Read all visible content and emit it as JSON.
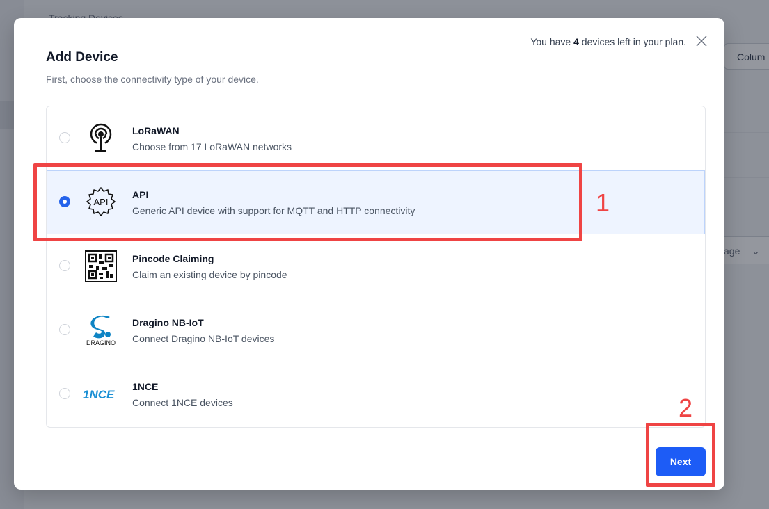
{
  "background": {
    "page_title": "Tracking Devices",
    "columns_label": "Colum",
    "page_select_label": "age"
  },
  "modal": {
    "title": "Add Device",
    "subtitle": "First, choose the connectivity type of your device.",
    "plan_prefix": "You have ",
    "plan_count": "4",
    "plan_suffix": " devices left in your plan.",
    "options": [
      {
        "name": "LoRaWAN",
        "desc": "Choose from 17 LoRaWAN networks",
        "icon": "antenna-icon",
        "selected": false
      },
      {
        "name": "API",
        "desc": "Generic API device with support for MQTT and HTTP connectivity",
        "icon": "api-gear-icon",
        "selected": true
      },
      {
        "name": "Pincode Claiming",
        "desc": "Claim an existing device by pincode",
        "icon": "qr-code-icon",
        "selected": false
      },
      {
        "name": "Dragino NB-IoT",
        "desc": "Connect Dragino NB-IoT devices",
        "icon": "dragino-logo",
        "selected": false
      },
      {
        "name": "1NCE",
        "desc": "Connect 1NCE devices",
        "icon": "1nce-logo",
        "selected": false
      }
    ],
    "next_label": "Next"
  },
  "icons": {
    "api_icon_text": "API",
    "dragino_logo_text": "DRAGINO",
    "nce_logo_text": "1NCE"
  },
  "annotations": {
    "label_1": "1",
    "label_2": "2",
    "color": "#ef4444"
  }
}
